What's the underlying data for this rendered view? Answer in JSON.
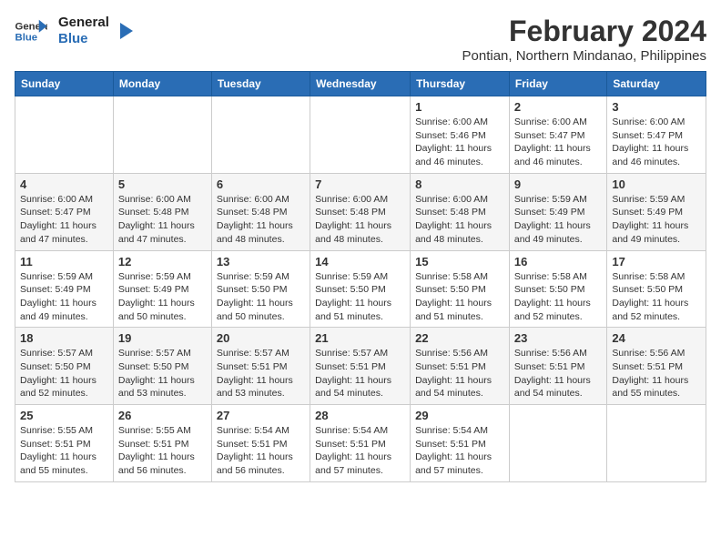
{
  "header": {
    "logo_line1": "General",
    "logo_line2": "Blue",
    "month_year": "February 2024",
    "location": "Pontian, Northern Mindanao, Philippines"
  },
  "weekdays": [
    "Sunday",
    "Monday",
    "Tuesday",
    "Wednesday",
    "Thursday",
    "Friday",
    "Saturday"
  ],
  "weeks": [
    [
      {
        "day": "",
        "info": ""
      },
      {
        "day": "",
        "info": ""
      },
      {
        "day": "",
        "info": ""
      },
      {
        "day": "",
        "info": ""
      },
      {
        "day": "1",
        "info": "Sunrise: 6:00 AM\nSunset: 5:46 PM\nDaylight: 11 hours\nand 46 minutes."
      },
      {
        "day": "2",
        "info": "Sunrise: 6:00 AM\nSunset: 5:47 PM\nDaylight: 11 hours\nand 46 minutes."
      },
      {
        "day": "3",
        "info": "Sunrise: 6:00 AM\nSunset: 5:47 PM\nDaylight: 11 hours\nand 46 minutes."
      }
    ],
    [
      {
        "day": "4",
        "info": "Sunrise: 6:00 AM\nSunset: 5:47 PM\nDaylight: 11 hours\nand 47 minutes."
      },
      {
        "day": "5",
        "info": "Sunrise: 6:00 AM\nSunset: 5:48 PM\nDaylight: 11 hours\nand 47 minutes."
      },
      {
        "day": "6",
        "info": "Sunrise: 6:00 AM\nSunset: 5:48 PM\nDaylight: 11 hours\nand 48 minutes."
      },
      {
        "day": "7",
        "info": "Sunrise: 6:00 AM\nSunset: 5:48 PM\nDaylight: 11 hours\nand 48 minutes."
      },
      {
        "day": "8",
        "info": "Sunrise: 6:00 AM\nSunset: 5:48 PM\nDaylight: 11 hours\nand 48 minutes."
      },
      {
        "day": "9",
        "info": "Sunrise: 5:59 AM\nSunset: 5:49 PM\nDaylight: 11 hours\nand 49 minutes."
      },
      {
        "day": "10",
        "info": "Sunrise: 5:59 AM\nSunset: 5:49 PM\nDaylight: 11 hours\nand 49 minutes."
      }
    ],
    [
      {
        "day": "11",
        "info": "Sunrise: 5:59 AM\nSunset: 5:49 PM\nDaylight: 11 hours\nand 49 minutes."
      },
      {
        "day": "12",
        "info": "Sunrise: 5:59 AM\nSunset: 5:49 PM\nDaylight: 11 hours\nand 50 minutes."
      },
      {
        "day": "13",
        "info": "Sunrise: 5:59 AM\nSunset: 5:50 PM\nDaylight: 11 hours\nand 50 minutes."
      },
      {
        "day": "14",
        "info": "Sunrise: 5:59 AM\nSunset: 5:50 PM\nDaylight: 11 hours\nand 51 minutes."
      },
      {
        "day": "15",
        "info": "Sunrise: 5:58 AM\nSunset: 5:50 PM\nDaylight: 11 hours\nand 51 minutes."
      },
      {
        "day": "16",
        "info": "Sunrise: 5:58 AM\nSunset: 5:50 PM\nDaylight: 11 hours\nand 52 minutes."
      },
      {
        "day": "17",
        "info": "Sunrise: 5:58 AM\nSunset: 5:50 PM\nDaylight: 11 hours\nand 52 minutes."
      }
    ],
    [
      {
        "day": "18",
        "info": "Sunrise: 5:57 AM\nSunset: 5:50 PM\nDaylight: 11 hours\nand 52 minutes."
      },
      {
        "day": "19",
        "info": "Sunrise: 5:57 AM\nSunset: 5:50 PM\nDaylight: 11 hours\nand 53 minutes."
      },
      {
        "day": "20",
        "info": "Sunrise: 5:57 AM\nSunset: 5:51 PM\nDaylight: 11 hours\nand 53 minutes."
      },
      {
        "day": "21",
        "info": "Sunrise: 5:57 AM\nSunset: 5:51 PM\nDaylight: 11 hours\nand 54 minutes."
      },
      {
        "day": "22",
        "info": "Sunrise: 5:56 AM\nSunset: 5:51 PM\nDaylight: 11 hours\nand 54 minutes."
      },
      {
        "day": "23",
        "info": "Sunrise: 5:56 AM\nSunset: 5:51 PM\nDaylight: 11 hours\nand 54 minutes."
      },
      {
        "day": "24",
        "info": "Sunrise: 5:56 AM\nSunset: 5:51 PM\nDaylight: 11 hours\nand 55 minutes."
      }
    ],
    [
      {
        "day": "25",
        "info": "Sunrise: 5:55 AM\nSunset: 5:51 PM\nDaylight: 11 hours\nand 55 minutes."
      },
      {
        "day": "26",
        "info": "Sunrise: 5:55 AM\nSunset: 5:51 PM\nDaylight: 11 hours\nand 56 minutes."
      },
      {
        "day": "27",
        "info": "Sunrise: 5:54 AM\nSunset: 5:51 PM\nDaylight: 11 hours\nand 56 minutes."
      },
      {
        "day": "28",
        "info": "Sunrise: 5:54 AM\nSunset: 5:51 PM\nDaylight: 11 hours\nand 57 minutes."
      },
      {
        "day": "29",
        "info": "Sunrise: 5:54 AM\nSunset: 5:51 PM\nDaylight: 11 hours\nand 57 minutes."
      },
      {
        "day": "",
        "info": ""
      },
      {
        "day": "",
        "info": ""
      }
    ]
  ]
}
